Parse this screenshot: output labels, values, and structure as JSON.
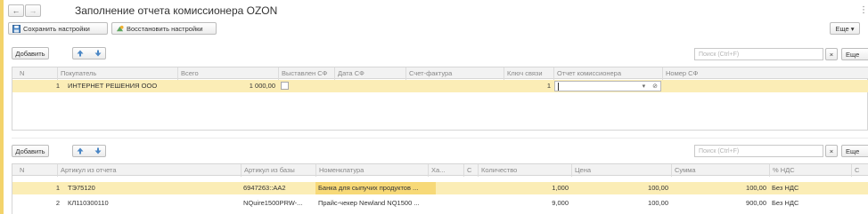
{
  "window": {
    "title": "Заполнение отчета комиссионера OZON",
    "back_label": "←",
    "forward_label": "→",
    "menu_label": "⋮"
  },
  "toolbar": {
    "save_settings": "Сохранить настройки",
    "restore_settings": "Восстановить настройки",
    "more_label": "Еще ▾"
  },
  "table1": {
    "add_label": "Добавить",
    "search_placeholder": "Поиск (Ctrl+F)",
    "clear_label": "×",
    "more_label": "Еще",
    "columns": [
      "N",
      "Покупатель",
      "Всего",
      "Выставлен СФ",
      "Дата СФ",
      "Счет-фактура",
      "Ключ связи",
      "Отчет комиссионера",
      "Номер СФ"
    ],
    "rows": [
      {
        "n": "1",
        "buyer": "ИНТЕРНЕТ РЕШЕНИЯ ООО",
        "total": "1 000,00",
        "issued": false,
        "date": "",
        "invoice": "",
        "key": "1",
        "report": "",
        "number": ""
      }
    ]
  },
  "table2": {
    "add_label": "Добавить",
    "search_placeholder": "Поиск (Ctrl+F)",
    "clear_label": "×",
    "more_label": "Еще",
    "columns": [
      "N",
      "Артикул из отчета",
      "Артикул из базы",
      "Номенклатура",
      "Ха...",
      "С",
      "Количество",
      "Цена",
      "Сумма",
      "% НДС",
      "С"
    ],
    "rows": [
      {
        "n": "1",
        "article_report": "ТЭ75120",
        "article_base": "6947263::AA2",
        "item": "Банка для сыпучих продуктов ...",
        "ch": "",
        "c": "",
        "qty": "1,000",
        "price": "100,00",
        "sum": "100,00",
        "vat": "Без НДС"
      },
      {
        "n": "2",
        "article_report": "КЛ110300110",
        "article_base": "NQuire1500PRW-...",
        "item": "Прайс-чекер Newland NQ1500 ...",
        "ch": "",
        "c": "",
        "qty": "9,000",
        "price": "100,00",
        "sum": "900,00",
        "vat": "Без НДС"
      }
    ]
  },
  "colors": {
    "selected_row": "#fbedb6",
    "selected_cell": "#f7d978",
    "arrow_up": "#4a86c5",
    "arrow_down": "#4a86c5",
    "left_accent": "#f3d36b"
  },
  "icons": [
    "back-arrow-icon",
    "forward-arrow-icon",
    "save-disk-icon",
    "restore-icon",
    "arrow-up-icon",
    "arrow-down-icon",
    "dropdown-icon",
    "link-icon",
    "kebab-menu-icon"
  ]
}
